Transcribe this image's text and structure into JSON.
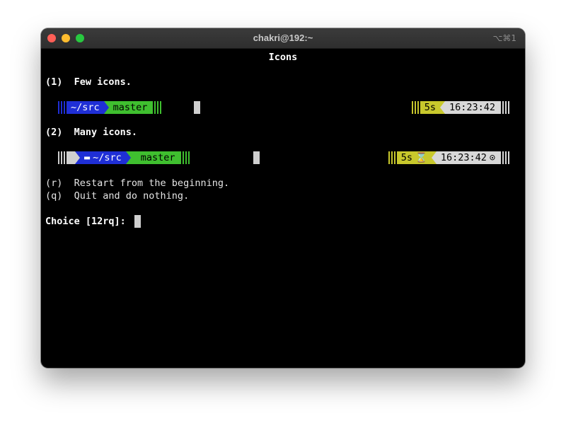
{
  "window": {
    "title": "chakri@192:~",
    "shortcut": "⌥⌘1"
  },
  "heading": "Icons",
  "option1": {
    "label": "(1)  Few icons.",
    "left": {
      "dir": "~/src",
      "branch": "master"
    },
    "right": {
      "duration": "5s",
      "time": "16:23:42"
    }
  },
  "option2": {
    "label": "(2)  Many icons.",
    "left": {
      "os_icon": "",
      "dir": "~/src",
      "git_icon": "",
      "branch_icon": "",
      "branch": "master"
    },
    "right": {
      "duration": "5s",
      "hourglass": "⌛",
      "time": "16:23:42",
      "clock": "⊙"
    }
  },
  "restart": "(r)  Restart from the beginning.",
  "quit": "(q)  Quit and do nothing.",
  "choice_prompt": "Choice [12rq]: ",
  "colors": {
    "dir_bg": "#1f2fd6",
    "git_bg": "#3fbf2f",
    "duration_bg": "#c8c82c",
    "time_bg": "#d8d8d8",
    "os_bg": "#cfcfcf"
  }
}
